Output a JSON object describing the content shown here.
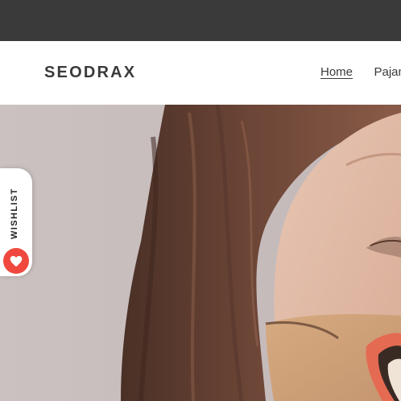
{
  "header": {
    "logo": "SEODRAX",
    "nav": [
      {
        "label": "Home",
        "active": true
      },
      {
        "label": "Pajamas",
        "active": false
      }
    ]
  },
  "hero": {
    "image": "woman-wearing-printed-face-mask"
  },
  "wishlist": {
    "label": "WISHLIST",
    "icon": "heart-icon",
    "color": "#f0483e"
  },
  "colors": {
    "announcement_bar": "#3a3a3a",
    "text": "#3a3a3a",
    "hero_background": "#c7bdbd"
  }
}
